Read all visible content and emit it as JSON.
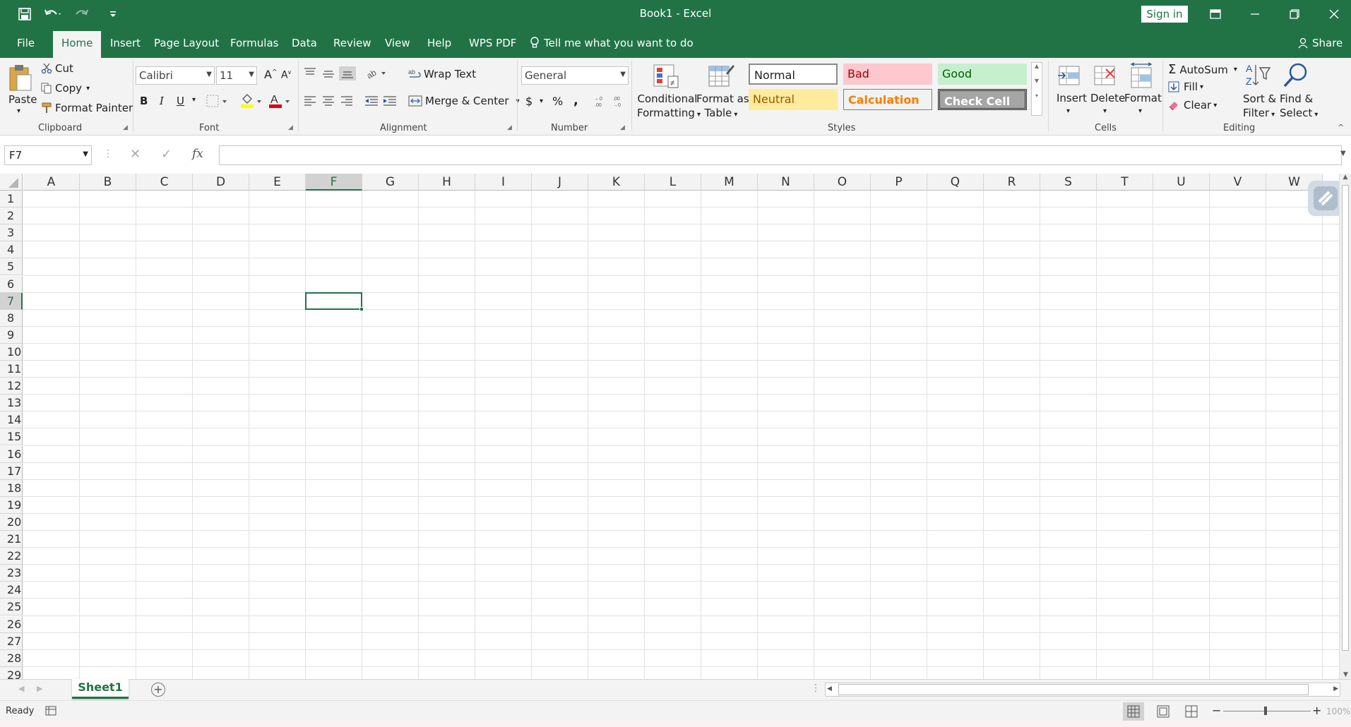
{
  "window": {
    "title": "Book1  -  Excel",
    "sign_in": "Sign in"
  },
  "menu": {
    "tabs": [
      "File",
      "Home",
      "Insert",
      "Page Layout",
      "Formulas",
      "Data",
      "Review",
      "View",
      "Help",
      "WPS PDF"
    ],
    "tell_me": "Tell me what you want to do",
    "share": "Share"
  },
  "ribbon": {
    "clipboard": {
      "paste": "Paste",
      "cut": "Cut",
      "copy": "Copy",
      "format_painter": "Format Painter",
      "label": "Clipboard"
    },
    "font": {
      "name": "Calibri",
      "size": "11",
      "bold": "B",
      "italic": "I",
      "underline": "U",
      "label": "Font"
    },
    "alignment": {
      "wrap_text": "Wrap Text",
      "merge_center": "Merge & Center",
      "label": "Alignment"
    },
    "number": {
      "format": "General",
      "currency": "$",
      "percent": "%",
      "comma": ",",
      "label": "Number"
    },
    "styles": {
      "conditional_formatting_1": "Conditional",
      "conditional_formatting_2": "Formatting",
      "format_as_table_1": "Format as",
      "format_as_table_2": "Table",
      "normal": "Normal",
      "bad": "Bad",
      "good": "Good",
      "neutral": "Neutral",
      "calculation": "Calculation",
      "check_cell": "Check Cell",
      "label": "Styles"
    },
    "cells": {
      "insert": "Insert",
      "delete": "Delete",
      "format": "Format",
      "label": "Cells"
    },
    "editing": {
      "autosum": "AutoSum",
      "fill": "Fill",
      "clear": "Clear",
      "sort_filter_1": "Sort &",
      "sort_filter_2": "Filter",
      "find_select_1": "Find &",
      "find_select_2": "Select",
      "label": "Editing"
    }
  },
  "formula_bar": {
    "name_box": "F7",
    "fx": "fx",
    "value": ""
  },
  "grid": {
    "columns": [
      "A",
      "B",
      "C",
      "D",
      "E",
      "F",
      "G",
      "H",
      "I",
      "J",
      "K",
      "L",
      "M",
      "N",
      "O",
      "P",
      "Q",
      "R",
      "S",
      "T",
      "U",
      "V",
      "W"
    ],
    "rows": [
      "1",
      "2",
      "3",
      "4",
      "5",
      "6",
      "7",
      "8",
      "9",
      "10",
      "11",
      "12",
      "13",
      "14",
      "15",
      "16",
      "17",
      "18",
      "19",
      "20",
      "21",
      "22",
      "23",
      "24",
      "25",
      "26",
      "27",
      "28",
      "29"
    ],
    "selected_column": "F",
    "selected_row": "7"
  },
  "sheets": {
    "active": "Sheet1"
  },
  "status": {
    "ready": "Ready",
    "zoom": "100%"
  },
  "colors": {
    "brand": "#217346",
    "bad_bg": "#ffc7ce",
    "bad_fg": "#9c0006",
    "good_bg": "#c6efce",
    "good_fg": "#006100",
    "neutral_bg": "#ffeb9c",
    "neutral_fg": "#9c5700",
    "calc_fg": "#fa7d00",
    "check_bg": "#a5a5a5"
  }
}
